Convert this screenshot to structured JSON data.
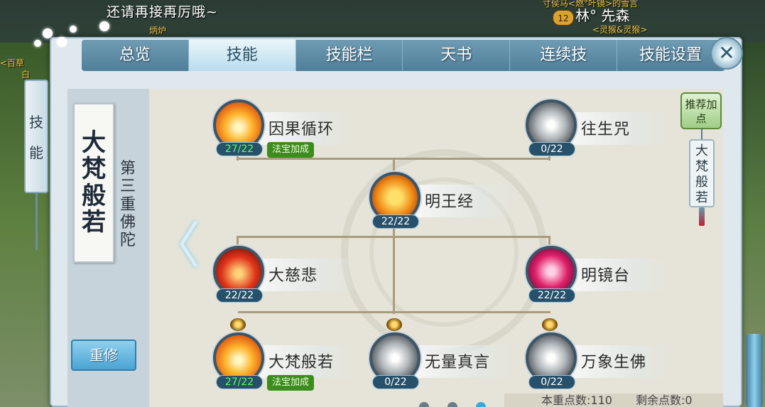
{
  "hud": {
    "system_message": "还请再接再厉哦~",
    "top_left_small": "炳炉",
    "top_right_text": "寸侯马<燃°叶镜>的雪言",
    "player_level": "12",
    "player_name": "林° 先森",
    "player_title": "<灵猴&灵猴>",
    "left_edge_text_1": "<百草",
    "left_edge_text_2": "白"
  },
  "tabs": [
    {
      "label": "总览",
      "active": false
    },
    {
      "label": "技能",
      "active": true
    },
    {
      "label": "技能栏",
      "active": false
    },
    {
      "label": "天书",
      "active": false
    },
    {
      "label": "连续技",
      "active": false
    },
    {
      "label": "技能设置",
      "active": false
    }
  ],
  "close_icon": "✕",
  "side_tab": {
    "chars": [
      "技",
      "能"
    ]
  },
  "school": {
    "name_chars": [
      "大",
      "梵",
      "般",
      "若"
    ],
    "subtitle_chars": [
      "第",
      "三",
      "重",
      "佛",
      "陀"
    ]
  },
  "back_arrow": "〈",
  "reset_button": "重修",
  "recommend_button": "推荐加点",
  "school_tag": [
    "大",
    "梵",
    "般",
    "若"
  ],
  "skills": [
    {
      "name": "因果循环",
      "count": "27/22",
      "full": true,
      "badge": "法宝加成",
      "icon": "fire",
      "icon_name": "karma-fire-icon"
    },
    {
      "name": "往生咒",
      "count": "0/22",
      "full": false,
      "badge": "",
      "icon": "grey",
      "icon_name": "rebirth-light-icon"
    },
    {
      "name": "明王经",
      "count": "22/22",
      "full": false,
      "badge": "",
      "icon": "shield",
      "icon_name": "golden-shield-icon"
    },
    {
      "name": "大慈悲",
      "count": "22/22",
      "full": false,
      "badge": "",
      "icon": "red",
      "icon_name": "compassion-buddha-icon"
    },
    {
      "name": "明镜台",
      "count": "22/22",
      "full": false,
      "badge": "",
      "icon": "pink",
      "icon_name": "mirror-shield-icon"
    },
    {
      "name": "大梵般若",
      "count": "27/22",
      "full": true,
      "badge": "法宝加成",
      "icon": "fire",
      "icon_name": "prajna-fire-icon"
    },
    {
      "name": "无量真言",
      "count": "0/22",
      "full": false,
      "badge": "",
      "icon": "grey",
      "icon_name": "mantra-light-icon"
    },
    {
      "name": "万象生佛",
      "count": "0/22",
      "full": false,
      "badge": "",
      "icon": "grey",
      "icon_name": "myriad-buddha-icon"
    }
  ],
  "footer": {
    "points_label": "本重点数:110",
    "remaining_label": "剩余点数:0"
  },
  "colors": {
    "tab_active_text": "#2b4e63",
    "full_count_green": "#59ff59",
    "badge_green": "#3c8c1e"
  }
}
